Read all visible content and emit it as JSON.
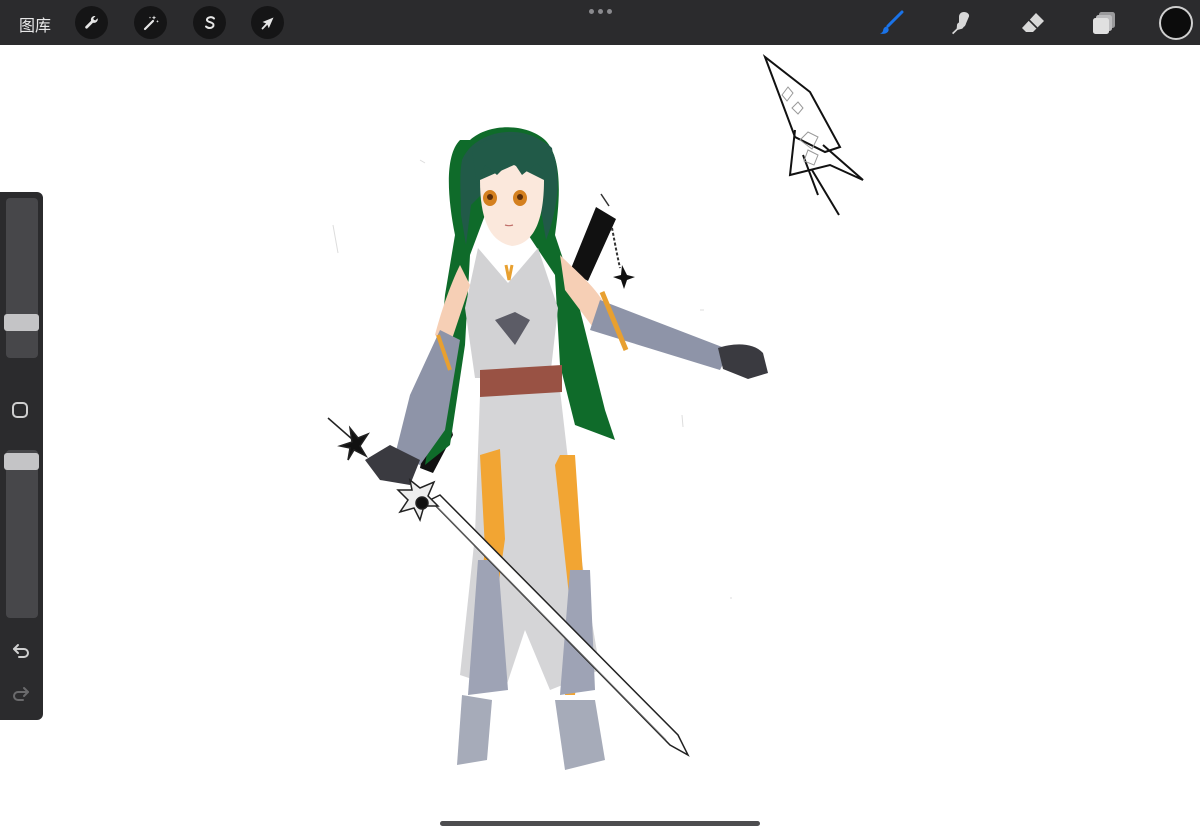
{
  "topbar": {
    "gallery_label": "图库",
    "left_tools": [
      {
        "icon": "wrench-icon",
        "name": "actions"
      },
      {
        "icon": "magic-wand-icon",
        "name": "adjustments"
      },
      {
        "icon": "selection-s-icon",
        "name": "selection"
      },
      {
        "icon": "arrow-cursor-icon",
        "name": "transform"
      }
    ],
    "right_tools": [
      {
        "icon": "brush-icon",
        "name": "paint",
        "active": true
      },
      {
        "icon": "smudge-icon",
        "name": "smudge"
      },
      {
        "icon": "eraser-icon",
        "name": "erase"
      },
      {
        "icon": "layers-icon",
        "name": "layers"
      }
    ],
    "current_color": "#0c0c0c",
    "accent_color": "#1a73e8"
  },
  "sidebar": {
    "brush_size_level": 0.35,
    "opacity_level": 0.05,
    "modify_icon": "square-modify-icon",
    "undo_icon": "undo-icon",
    "redo_icon": "redo-icon"
  },
  "canvas": {
    "artwork": "anime-swordswoman-illustration",
    "background": "#ffffff"
  }
}
